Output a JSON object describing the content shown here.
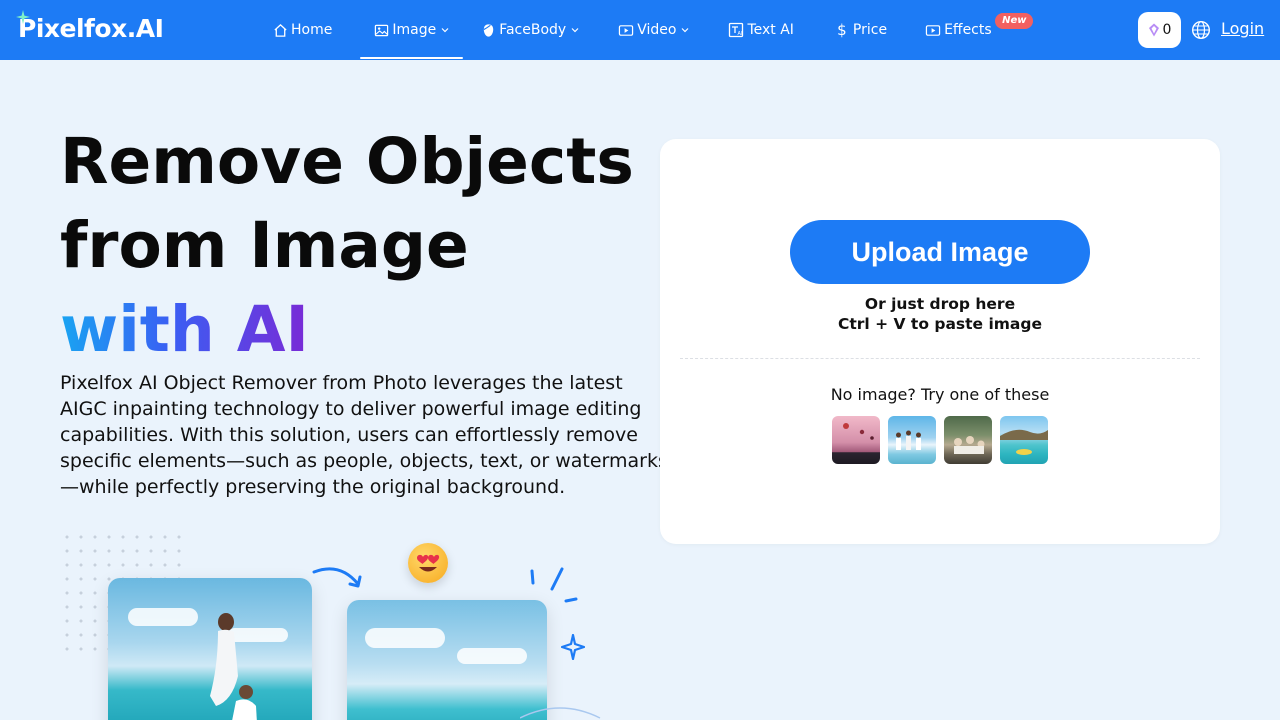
{
  "brand": {
    "name": "Pixelfox.AI"
  },
  "nav": {
    "items": [
      {
        "label": "Home",
        "icon": "home-icon",
        "dropdown": false,
        "active": false
      },
      {
        "label": "Image",
        "icon": "image-icon",
        "dropdown": true,
        "active": true
      },
      {
        "label": "FaceBody",
        "icon": "face-icon",
        "dropdown": true,
        "active": false
      },
      {
        "label": "Video",
        "icon": "video-icon",
        "dropdown": true,
        "active": false
      },
      {
        "label": "Text AI",
        "icon": "text-ai-icon",
        "dropdown": false,
        "active": false
      },
      {
        "label": "Price",
        "icon": "dollar-icon",
        "dropdown": false,
        "active": false
      },
      {
        "label": "Effects",
        "icon": "effects-icon",
        "dropdown": false,
        "active": false,
        "badge": "New"
      }
    ]
  },
  "account": {
    "credits": "0",
    "login_label": "Login"
  },
  "hero": {
    "title_line1": "Remove Objects",
    "title_line2": "from Image",
    "title_line3": "with AI",
    "description": "Pixelfox AI Object Remover from Photo leverages the latest AIGC inpainting technology to deliver powerful image editing capabilities. With this solution, users can effortlessly remove specific elements—such as people, objects, text, or watermarks—while perfectly preserving the original background."
  },
  "upload": {
    "button_label": "Upload Image",
    "drop_hint": "Or just drop here",
    "paste_hint": "Ctrl + V to paste image",
    "samples_label": "No image? Try one of these",
    "samples": [
      "sample-balloons",
      "sample-beach-group",
      "sample-forest-group",
      "sample-coast"
    ]
  },
  "colors": {
    "primary": "#1d7bf5",
    "badge": "#f26060",
    "background": "#eaf3fc"
  }
}
